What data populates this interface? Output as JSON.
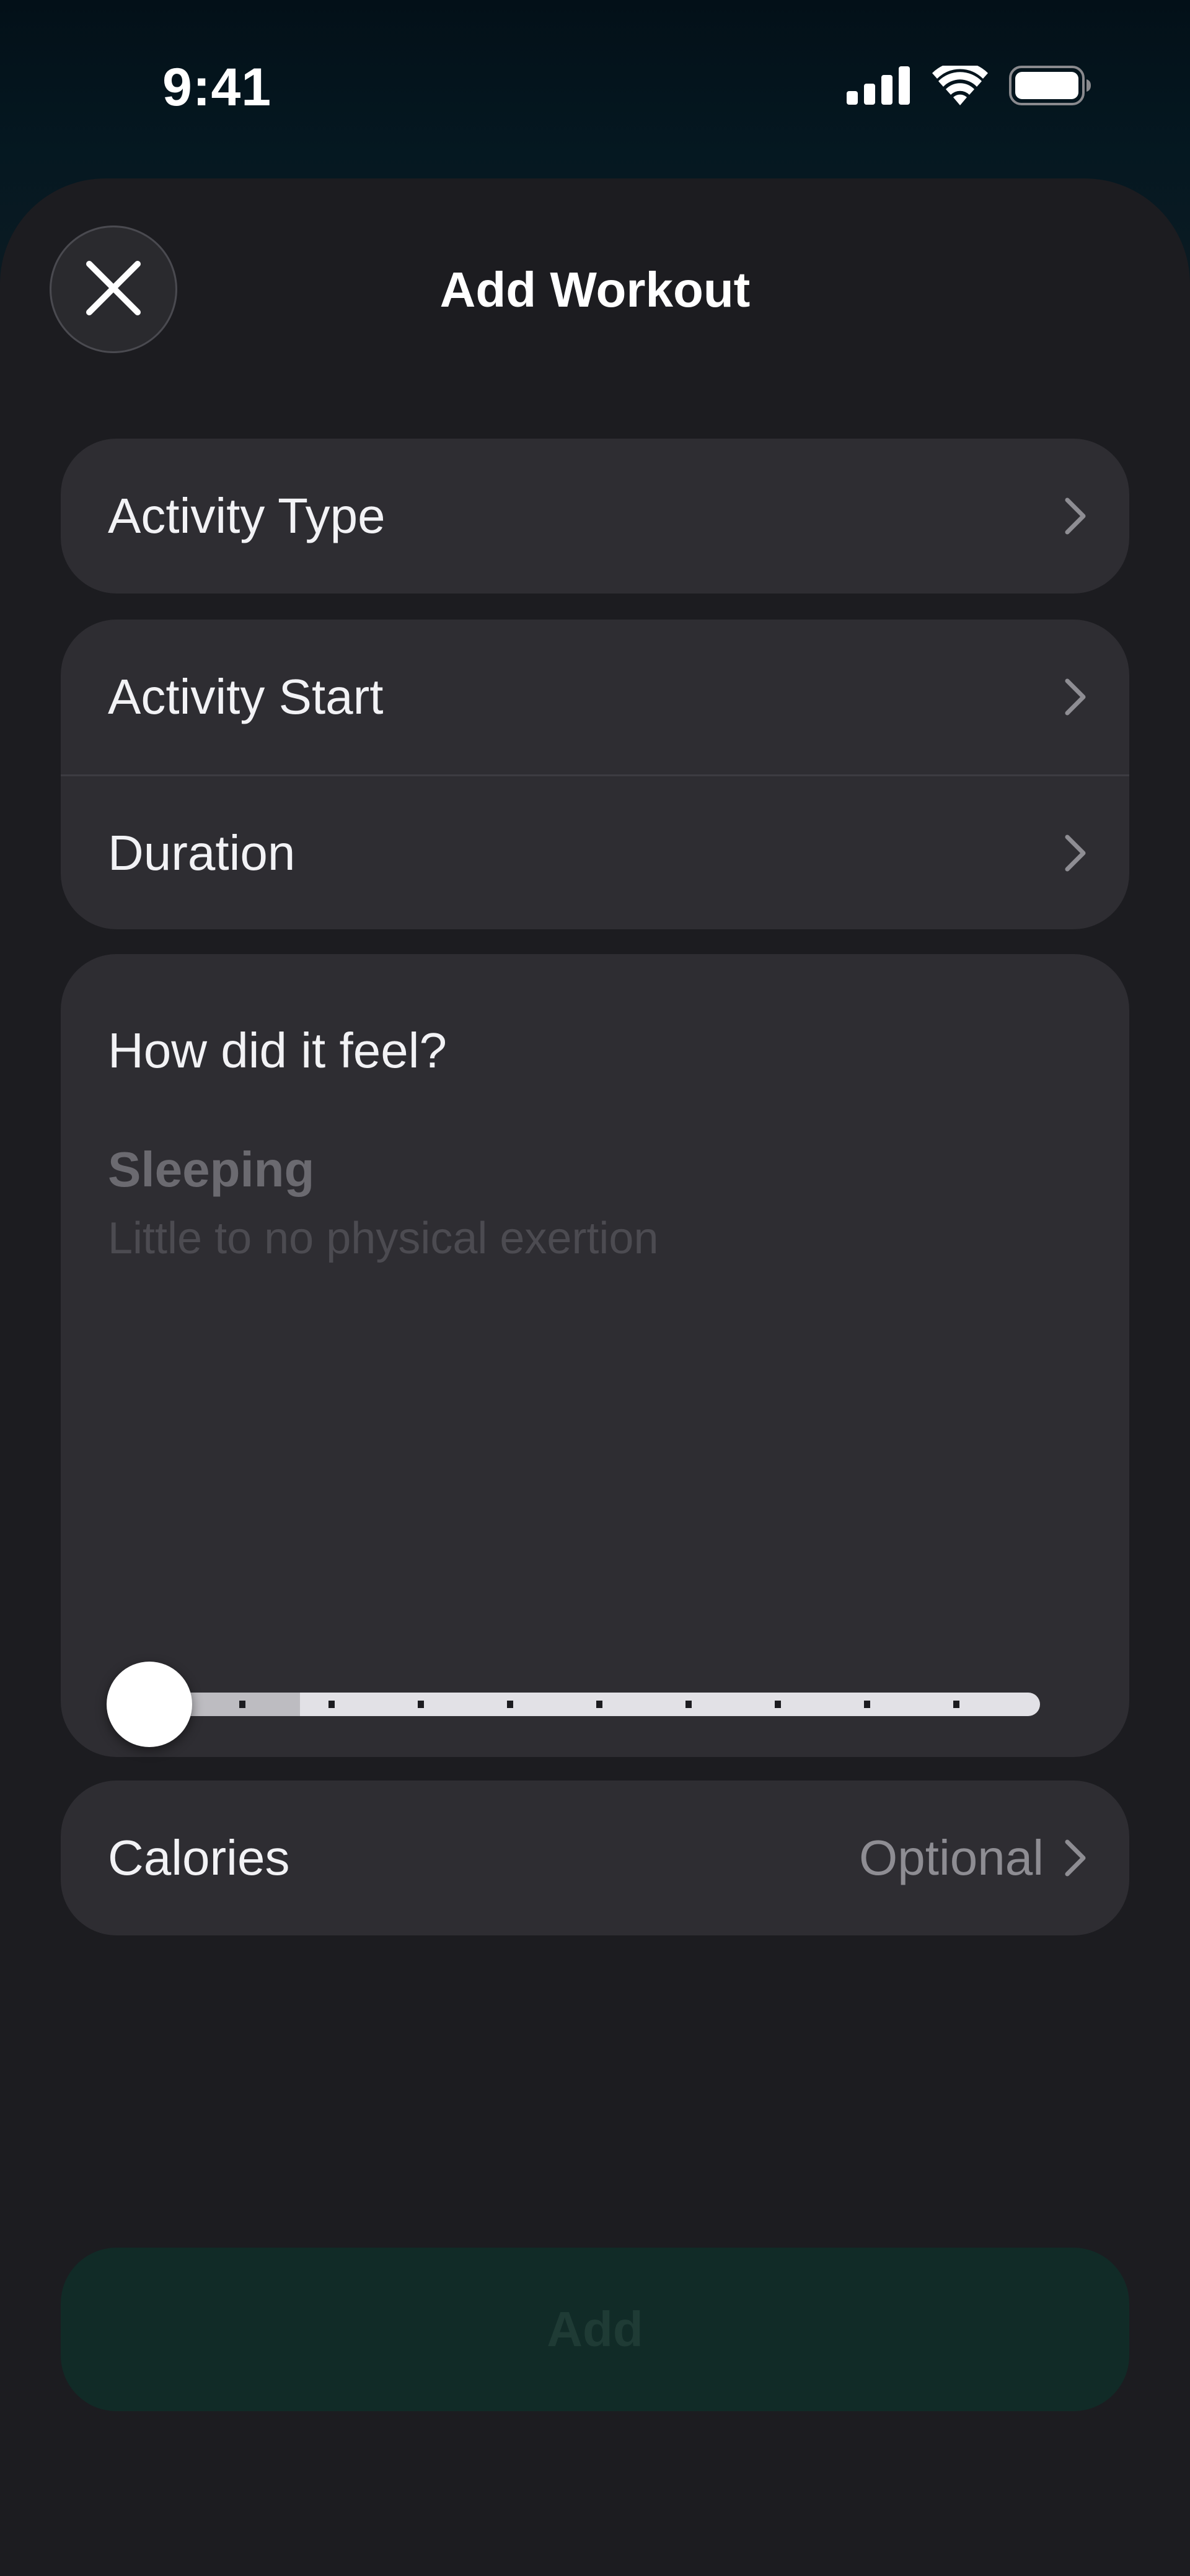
{
  "status_bar": {
    "time": "9:41",
    "icons": [
      "cellular-signal-icon",
      "wifi-icon",
      "battery-icon"
    ]
  },
  "sheet": {
    "title": "Add Workout",
    "close_icon": "close-icon"
  },
  "activity_group": {
    "activity_type_label": "Activity Type"
  },
  "time_group": {
    "activity_start_label": "Activity Start",
    "duration_label": "Duration"
  },
  "feel": {
    "title": "How did it feel?",
    "level": "Sleeping",
    "description": "Little to no physical exertion",
    "slider": {
      "value": 0,
      "min": 0,
      "max": 10,
      "steps": 10
    }
  },
  "calories": {
    "label": "Calories",
    "value": "Optional"
  },
  "add_button": {
    "label": "Add"
  },
  "colors": {
    "sheet_background": "#1c1c20",
    "card_background": "#2e2d32",
    "add_button_background": "#112b27",
    "secondary_text": "#8e8d93"
  }
}
